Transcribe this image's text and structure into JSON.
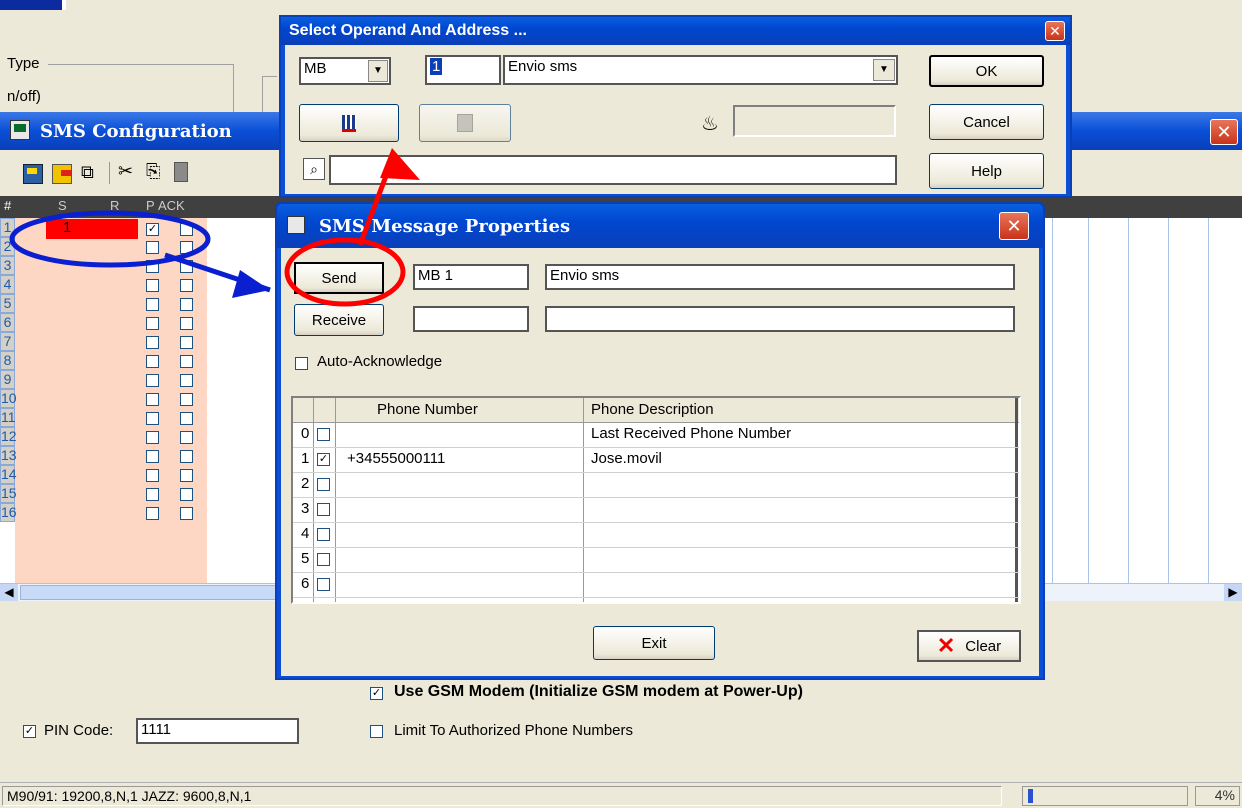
{
  "background": {
    "type_label": "Type",
    "onoff_label": "n/off)"
  },
  "sms_config": {
    "title": "SMS Configuration",
    "col_headers": [
      "#",
      "S",
      "R",
      "P",
      "ACK"
    ],
    "rows": [
      "1",
      "2",
      "3",
      "4",
      "5",
      "6",
      "7",
      "8",
      "9",
      "10",
      "11",
      "12",
      "13",
      "14",
      "15",
      "16"
    ],
    "row1_value": "1",
    "use_gsm_label": "Use GSM Modem (Initialize GSM modem at Power-Up)",
    "pin_label": "PIN Code:",
    "pin_value": "1111",
    "limit_label": "Limit To Authorized Phone Numbers",
    "status_text": "M90/91: 19200,8,N,1  JAZZ: 9600,8,N,1",
    "progress_text": "4%"
  },
  "operand_dialog": {
    "title": "Select Operand And Address ...",
    "operand_value": "MB",
    "address_value": "1",
    "description_value": "Envio sms",
    "ok_label": "OK",
    "cancel_label": "Cancel",
    "help_label": "Help"
  },
  "sms_props": {
    "title": "SMS Message Properties",
    "send_label": "Send",
    "send_operand": "MB 1",
    "send_description": "Envio sms",
    "receive_label": "Receive",
    "auto_ack_label": "Auto-Acknowledge",
    "table_headers": [
      "Phone Number",
      "Phone Description"
    ],
    "phone_rows": [
      {
        "idx": "0",
        "number": "",
        "desc": "Last Received Phone Number",
        "checked": false
      },
      {
        "idx": "1",
        "number": "+34555000111",
        "desc": "Jose.movil",
        "checked": true
      },
      {
        "idx": "2",
        "number": "",
        "desc": "",
        "checked": false
      },
      {
        "idx": "3",
        "number": "",
        "desc": "",
        "checked": false
      },
      {
        "idx": "4",
        "number": "",
        "desc": "",
        "checked": false
      },
      {
        "idx": "5",
        "number": "",
        "desc": "",
        "checked": false
      },
      {
        "idx": "6",
        "number": "",
        "desc": "",
        "checked": false
      }
    ],
    "exit_label": "Exit",
    "clear_label": "Clear"
  },
  "colors": {
    "annotation_red": "#ff0000",
    "annotation_blue": "#0a1fd0",
    "xp_title_blue": "#0047d0",
    "grid_salmon": "#fdd7c4"
  }
}
